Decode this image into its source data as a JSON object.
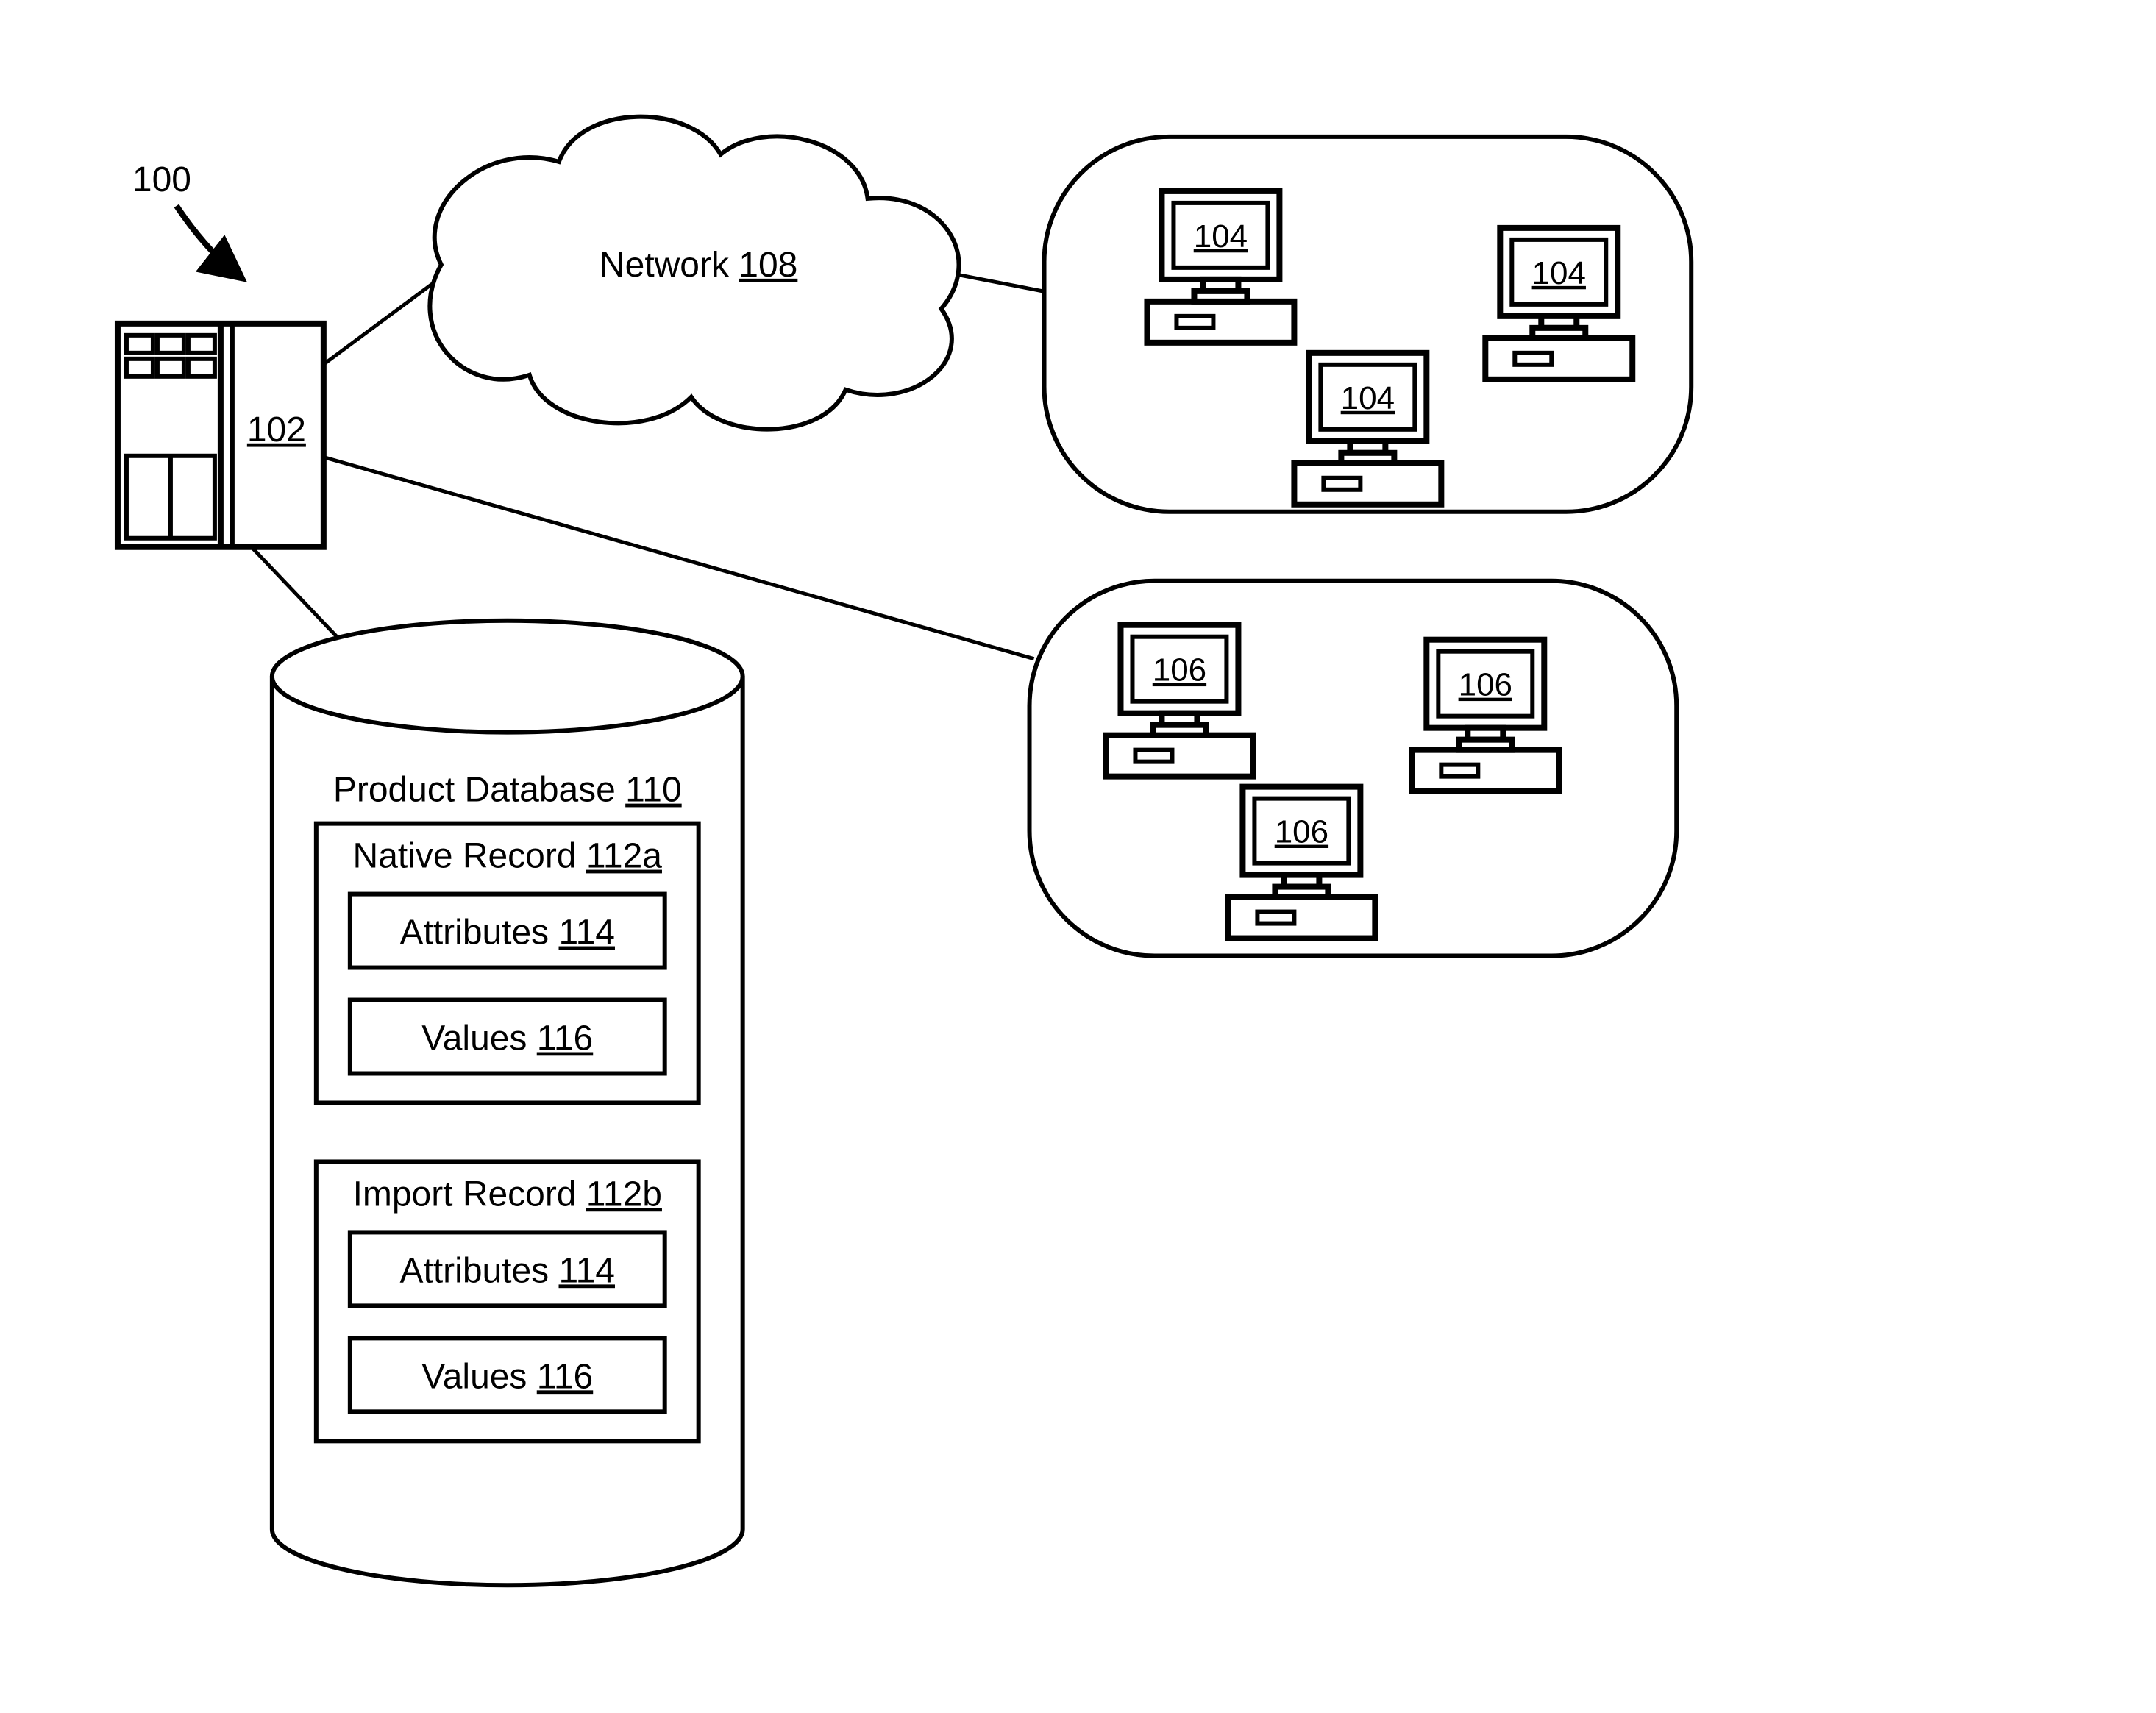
{
  "figure_ref": "100",
  "server": {
    "ref": "102"
  },
  "network": {
    "label": "Network",
    "ref": "108"
  },
  "client_group_top": {
    "ref": "104"
  },
  "client_group_bottom": {
    "ref": "106"
  },
  "database": {
    "title": "Product Database",
    "ref": "110",
    "records": [
      {
        "title": "Native Record",
        "ref": "112a",
        "fields": [
          {
            "label": "Attributes",
            "ref": "114"
          },
          {
            "label": "Values",
            "ref": "116"
          }
        ]
      },
      {
        "title": "Import Record",
        "ref": "112b",
        "fields": [
          {
            "label": "Attributes",
            "ref": "114"
          },
          {
            "label": "Values",
            "ref": "116"
          }
        ]
      }
    ]
  }
}
